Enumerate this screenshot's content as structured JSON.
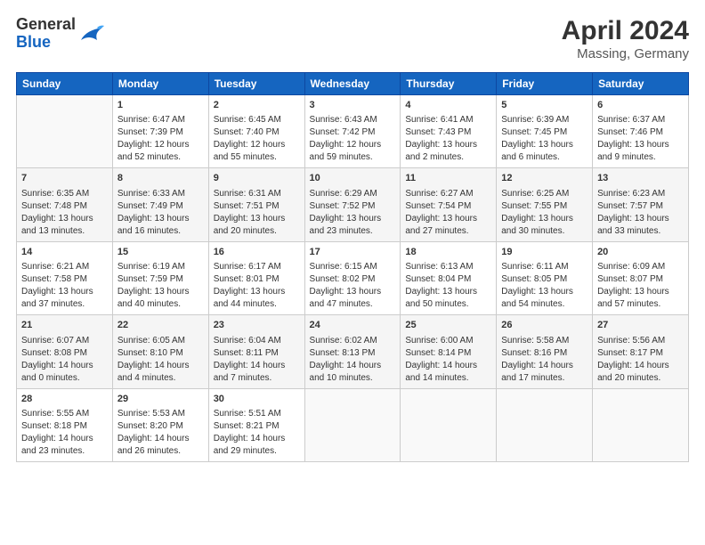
{
  "logo": {
    "general": "General",
    "blue": "Blue"
  },
  "title": "April 2024",
  "subtitle": "Massing, Germany",
  "days_header": [
    "Sunday",
    "Monday",
    "Tuesday",
    "Wednesday",
    "Thursday",
    "Friday",
    "Saturday"
  ],
  "weeks": [
    [
      {
        "day": "",
        "content": ""
      },
      {
        "day": "1",
        "content": "Sunrise: 6:47 AM\nSunset: 7:39 PM\nDaylight: 12 hours\nand 52 minutes."
      },
      {
        "day": "2",
        "content": "Sunrise: 6:45 AM\nSunset: 7:40 PM\nDaylight: 12 hours\nand 55 minutes."
      },
      {
        "day": "3",
        "content": "Sunrise: 6:43 AM\nSunset: 7:42 PM\nDaylight: 12 hours\nand 59 minutes."
      },
      {
        "day": "4",
        "content": "Sunrise: 6:41 AM\nSunset: 7:43 PM\nDaylight: 13 hours\nand 2 minutes."
      },
      {
        "day": "5",
        "content": "Sunrise: 6:39 AM\nSunset: 7:45 PM\nDaylight: 13 hours\nand 6 minutes."
      },
      {
        "day": "6",
        "content": "Sunrise: 6:37 AM\nSunset: 7:46 PM\nDaylight: 13 hours\nand 9 minutes."
      }
    ],
    [
      {
        "day": "7",
        "content": "Sunrise: 6:35 AM\nSunset: 7:48 PM\nDaylight: 13 hours\nand 13 minutes."
      },
      {
        "day": "8",
        "content": "Sunrise: 6:33 AM\nSunset: 7:49 PM\nDaylight: 13 hours\nand 16 minutes."
      },
      {
        "day": "9",
        "content": "Sunrise: 6:31 AM\nSunset: 7:51 PM\nDaylight: 13 hours\nand 20 minutes."
      },
      {
        "day": "10",
        "content": "Sunrise: 6:29 AM\nSunset: 7:52 PM\nDaylight: 13 hours\nand 23 minutes."
      },
      {
        "day": "11",
        "content": "Sunrise: 6:27 AM\nSunset: 7:54 PM\nDaylight: 13 hours\nand 27 minutes."
      },
      {
        "day": "12",
        "content": "Sunrise: 6:25 AM\nSunset: 7:55 PM\nDaylight: 13 hours\nand 30 minutes."
      },
      {
        "day": "13",
        "content": "Sunrise: 6:23 AM\nSunset: 7:57 PM\nDaylight: 13 hours\nand 33 minutes."
      }
    ],
    [
      {
        "day": "14",
        "content": "Sunrise: 6:21 AM\nSunset: 7:58 PM\nDaylight: 13 hours\nand 37 minutes."
      },
      {
        "day": "15",
        "content": "Sunrise: 6:19 AM\nSunset: 7:59 PM\nDaylight: 13 hours\nand 40 minutes."
      },
      {
        "day": "16",
        "content": "Sunrise: 6:17 AM\nSunset: 8:01 PM\nDaylight: 13 hours\nand 44 minutes."
      },
      {
        "day": "17",
        "content": "Sunrise: 6:15 AM\nSunset: 8:02 PM\nDaylight: 13 hours\nand 47 minutes."
      },
      {
        "day": "18",
        "content": "Sunrise: 6:13 AM\nSunset: 8:04 PM\nDaylight: 13 hours\nand 50 minutes."
      },
      {
        "day": "19",
        "content": "Sunrise: 6:11 AM\nSunset: 8:05 PM\nDaylight: 13 hours\nand 54 minutes."
      },
      {
        "day": "20",
        "content": "Sunrise: 6:09 AM\nSunset: 8:07 PM\nDaylight: 13 hours\nand 57 minutes."
      }
    ],
    [
      {
        "day": "21",
        "content": "Sunrise: 6:07 AM\nSunset: 8:08 PM\nDaylight: 14 hours\nand 0 minutes."
      },
      {
        "day": "22",
        "content": "Sunrise: 6:05 AM\nSunset: 8:10 PM\nDaylight: 14 hours\nand 4 minutes."
      },
      {
        "day": "23",
        "content": "Sunrise: 6:04 AM\nSunset: 8:11 PM\nDaylight: 14 hours\nand 7 minutes."
      },
      {
        "day": "24",
        "content": "Sunrise: 6:02 AM\nSunset: 8:13 PM\nDaylight: 14 hours\nand 10 minutes."
      },
      {
        "day": "25",
        "content": "Sunrise: 6:00 AM\nSunset: 8:14 PM\nDaylight: 14 hours\nand 14 minutes."
      },
      {
        "day": "26",
        "content": "Sunrise: 5:58 AM\nSunset: 8:16 PM\nDaylight: 14 hours\nand 17 minutes."
      },
      {
        "day": "27",
        "content": "Sunrise: 5:56 AM\nSunset: 8:17 PM\nDaylight: 14 hours\nand 20 minutes."
      }
    ],
    [
      {
        "day": "28",
        "content": "Sunrise: 5:55 AM\nSunset: 8:18 PM\nDaylight: 14 hours\nand 23 minutes."
      },
      {
        "day": "29",
        "content": "Sunrise: 5:53 AM\nSunset: 8:20 PM\nDaylight: 14 hours\nand 26 minutes."
      },
      {
        "day": "30",
        "content": "Sunrise: 5:51 AM\nSunset: 8:21 PM\nDaylight: 14 hours\nand 29 minutes."
      },
      {
        "day": "",
        "content": ""
      },
      {
        "day": "",
        "content": ""
      },
      {
        "day": "",
        "content": ""
      },
      {
        "day": "",
        "content": ""
      }
    ]
  ]
}
